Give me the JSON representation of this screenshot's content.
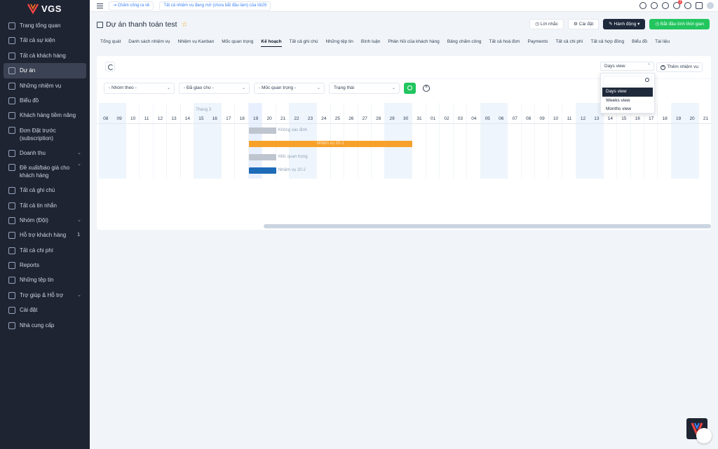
{
  "brand": {
    "name": "VGS",
    "accent": "#ef4444"
  },
  "sidebar": {
    "items": [
      {
        "label": "Trang tổng quan",
        "icon": "monitor-icon"
      },
      {
        "label": "Tất cả sự kiện",
        "icon": "calendar-icon"
      },
      {
        "label": "Tất cả khách hàng",
        "icon": "briefcase-icon"
      },
      {
        "label": "Dự án",
        "icon": "command-icon",
        "active": true
      },
      {
        "label": "Những nhiệm vụ",
        "icon": "check-circle-icon"
      },
      {
        "label": "Biểu đồ",
        "icon": "pie-chart-icon"
      },
      {
        "label": "Khách hàng tiềm năng",
        "icon": "layers-icon"
      },
      {
        "label": "Đơn Đặt trước (subscription)",
        "icon": "repeat-icon"
      },
      {
        "label": "Doanh thu",
        "icon": "cart-icon",
        "chevron": "⌄"
      },
      {
        "label": "Đề xuất/báo giá cho khách hàng",
        "icon": "anchor-icon",
        "chevron": "⌄"
      },
      {
        "label": "Tất cả ghi chú",
        "icon": "book-icon"
      },
      {
        "label": "Tất cả tin nhắn",
        "icon": "message-icon"
      },
      {
        "label": "Nhóm (Đội)",
        "icon": "users-icon",
        "chevron": "⌄"
      },
      {
        "label": "Hỗ trợ khách hàng",
        "icon": "life-buoy-icon",
        "count": "1"
      },
      {
        "label": "Tất cả chi phí",
        "icon": "plus-circle-icon"
      },
      {
        "label": "Reports",
        "icon": "reports-icon"
      },
      {
        "label": "Những tệp tin",
        "icon": "folder-icon"
      },
      {
        "label": "Trợ giúp & Hỗ trợ",
        "icon": "help-icon",
        "chevron": "⌄"
      },
      {
        "label": "Cài đặt",
        "icon": "settings-icon"
      },
      {
        "label": "Nhà cung cấp",
        "icon": "user-icon"
      }
    ]
  },
  "topbar": {
    "clock_chip": "Chấm công ra về",
    "task_chip": "Tất cả nhiệm vụ đang mở (chưa bắt đầu làm) của tôi29",
    "notification_count": "1"
  },
  "header": {
    "title": "Dự án thanh toán test",
    "remind_btn": "Lời nhắc",
    "settings_btn": "Cài đặt",
    "action_btn": "Hành động",
    "timer_btn": "Bắt đầu tính thời gian"
  },
  "tabs": [
    {
      "label": "Tổng quát"
    },
    {
      "label": "Danh sách nhiệm vụ"
    },
    {
      "label": "Nhiệm vụ Kanban"
    },
    {
      "label": "Mốc quan trọng"
    },
    {
      "label": "Kế hoạch",
      "active": true
    },
    {
      "label": "Tất cả ghi chú"
    },
    {
      "label": "Những tệp tin"
    },
    {
      "label": "Bình luận"
    },
    {
      "label": "Phản hồi của khách hàng"
    },
    {
      "label": "Bảng chấm công"
    },
    {
      "label": "Tất cả hoá đơn"
    },
    {
      "label": "Payments"
    },
    {
      "label": "Tất cả chi phí"
    },
    {
      "label": "Tất cả hợp đồng"
    },
    {
      "label": "Biểu đồ"
    },
    {
      "label": "Tài liệu"
    }
  ],
  "gantt": {
    "view_select": "Days view",
    "view_options": [
      "Days view",
      "Weeks view",
      "Months view"
    ],
    "add_task": "Thêm nhiệm vụ",
    "filters": [
      "- Nhóm theo -",
      "- Đã giao cho -",
      "- Mốc quan trọng -",
      "Trạng thái"
    ],
    "month_label": "Tháng 3",
    "days": [
      "08",
      "09",
      "10",
      "11",
      "12",
      "13",
      "14",
      "15",
      "16",
      "17",
      "18",
      "19",
      "20",
      "21",
      "22",
      "23",
      "24",
      "25",
      "26",
      "27",
      "28",
      "29",
      "30",
      "31",
      "01",
      "02",
      "03",
      "04",
      "05",
      "06",
      "07",
      "08",
      "09",
      "10",
      "11",
      "12",
      "13",
      "14",
      "15",
      "16",
      "17",
      "18",
      "19",
      "20",
      "21"
    ],
    "weekend_idx": [
      0,
      1,
      7,
      8,
      14,
      15,
      21,
      22,
      28,
      29,
      35,
      36,
      42,
      43
    ],
    "highlight_idx": [
      11
    ],
    "bars": [
      {
        "label": "Không xác định",
        "start": 11,
        "span": 2,
        "color": "#bfc5cf",
        "label_outside": true
      },
      {
        "label": "Nhiệm vụ 20-1",
        "start": 11,
        "span": 12,
        "color": "#f7a12b",
        "label_outside": false
      },
      {
        "label": "Mốc quan trọng",
        "start": 11,
        "span": 2,
        "color": "#bfc5cf",
        "label_outside": true
      },
      {
        "label": "Nhiệm vụ 20-2",
        "start": 11,
        "span": 2,
        "color": "#1e6bb8",
        "label_outside": true
      }
    ]
  }
}
